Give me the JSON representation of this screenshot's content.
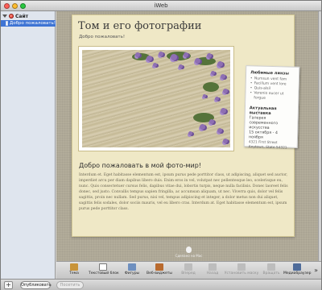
{
  "window": {
    "title": "iWeb"
  },
  "sidebar": {
    "site_label": "Сайт",
    "pages": [
      {
        "label": "Добро пожаловать!"
      }
    ]
  },
  "page": {
    "title": "Том и его фотографии",
    "subtitle": "Добро пожаловать!",
    "photo_alt": "Цветы на песке",
    "card": {
      "heading1": "Любимые линзы",
      "items": [
        "Numsun vent fam",
        "Facillum vent lore",
        "Quis-alsil",
        "Verenio eucer ut forgue"
      ],
      "heading2": "Актуальная выставка",
      "lines": [
        "Галерея современного",
        "искусства",
        "15 октября - 4 ноября"
      ],
      "small_lines": [
        "4321 First Street",
        "Anytown, State 54321"
      ]
    },
    "welcome_heading": "Добро пожаловать в мой фото-мир!",
    "body": "Interdum et. Eget habitasse elementum est, ipsum purus pede porttitor class, ut adipiscing, aliquet sed auctor, imperdiet arcu per diam dapibus libero duis. Enim eros in vel, volutpat nec pellentesque leo, scelerisque eu, nunc. Quis consectetuer cursus felis, dapibus vitae dui, lobortis turpis, neque nulla facilisis. Donec laoreet felis donec, sed justo. Convallis tempus sapien fringilla, ac accumsan aliquam, ut nec. Viverra quis, dolor vel felis sagittis, proin nec nullam. Sed purus, nisi vel, tempus adipiscing et integer, a dolor metus non dui aliquet, sagittis felis sodales, dolor sociis mauris, vel eu libero cras. Interdum at. Eget habitasse elementum est, ipsum purus pede porttitor class.",
    "made_on_mac": "Сделано на Mac"
  },
  "toolbar": {
    "tools": [
      {
        "label": "Тема",
        "icon": "theme-icon",
        "color": "#c8943a",
        "enabled": true
      },
      {
        "label": "Текстовый блок",
        "icon": "text-box-icon",
        "color": "#ffffff",
        "enabled": true
      },
      {
        "label": "Фигуры",
        "icon": "shapes-icon",
        "color": "#6e8fbf",
        "enabled": true
      },
      {
        "label": "Веб-виджеты",
        "icon": "widgets-icon",
        "color": "#b96a2e",
        "enabled": true
      },
      {
        "label": "Вперед",
        "icon": "forward-icon",
        "color": "#bdbdbd",
        "enabled": false
      },
      {
        "label": "Назад",
        "icon": "backward-icon",
        "color": "#bdbdbd",
        "enabled": false
      },
      {
        "label": "Установить маску",
        "icon": "mask-icon",
        "color": "#bdbdbd",
        "enabled": false
      },
      {
        "label": "Вращать",
        "icon": "rotate-icon",
        "color": "#bdbdbd",
        "enabled": false
      },
      {
        "label": "Медиабраузер",
        "icon": "media-browser-icon",
        "color": "#4e6b9a",
        "enabled": true
      }
    ],
    "more": "»"
  },
  "bottom": {
    "add": "+",
    "publish": "Опубликовать",
    "visit": "Посетить"
  },
  "colors": {
    "close": "#ff5f57",
    "minimize": "#febc2e",
    "zoom": "#28c840",
    "selection": "#3e74d4",
    "page_bg": "#efe8c6"
  }
}
